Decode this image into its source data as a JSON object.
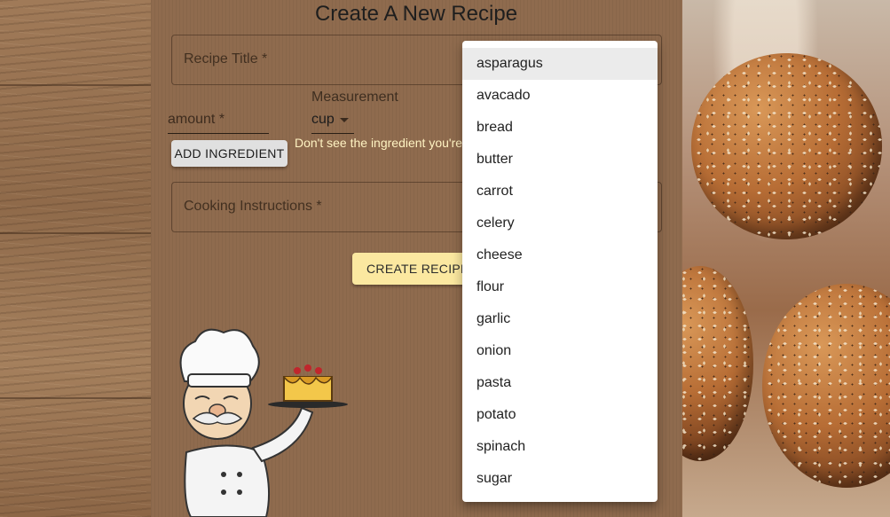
{
  "page": {
    "title": "Create A New Recipe"
  },
  "form": {
    "recipe_title_label": "Recipe Title *",
    "amount_label": "amount *",
    "measurement_label": "Measurement",
    "measurement_value": "cup",
    "add_ingredient_label": "ADD INGREDIENT",
    "hint_text": "Don't see the ingredient you're",
    "instructions_label": "Cooking Instructions *",
    "create_label": "CREATE RECIPE"
  },
  "menu": {
    "items": [
      {
        "label": "asparagus",
        "selected": true
      },
      {
        "label": "avacado"
      },
      {
        "label": "bread"
      },
      {
        "label": "butter"
      },
      {
        "label": "carrot"
      },
      {
        "label": "celery"
      },
      {
        "label": "cheese"
      },
      {
        "label": "flour"
      },
      {
        "label": "garlic"
      },
      {
        "label": "onion"
      },
      {
        "label": "pasta"
      },
      {
        "label": "potato"
      },
      {
        "label": "spinach"
      },
      {
        "label": "sugar"
      }
    ]
  },
  "colors": {
    "panel": "#8f6b4e",
    "accent_button": "#fbe8a0",
    "hint": "#fff3c2"
  },
  "icons": {
    "select_caret": "chevron-down-icon",
    "chef": "chef-illustration"
  }
}
